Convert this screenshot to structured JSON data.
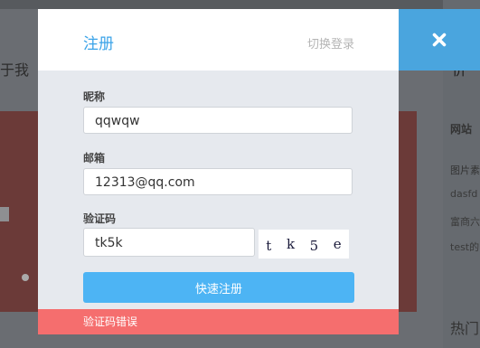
{
  "background": {
    "left_heading": "于我",
    "right_heading": "价",
    "right_section_title": "网站",
    "right_items": [
      "图片素",
      "dasfd",
      "富商六",
      "test的"
    ],
    "right_bottom_heading": "热门"
  },
  "modal": {
    "title": "注册",
    "switch_login": "切换登录",
    "close_icon": "close-icon",
    "fields": {
      "nickname": {
        "label": "昵称",
        "value": "qqwqw"
      },
      "email": {
        "label": "邮箱",
        "value": "12313@qq.com"
      },
      "captcha": {
        "label": "验证码",
        "value": "tk5k",
        "image_chars": [
          "t",
          "k",
          "5",
          "e"
        ]
      }
    },
    "submit_label": "快速注册",
    "error_message": "验证码错误"
  },
  "colors": {
    "accent": "#3aa3e8",
    "close_bg": "#4aa5de",
    "submit_bg": "#4db4f4",
    "error_bg": "#f56e6e"
  }
}
